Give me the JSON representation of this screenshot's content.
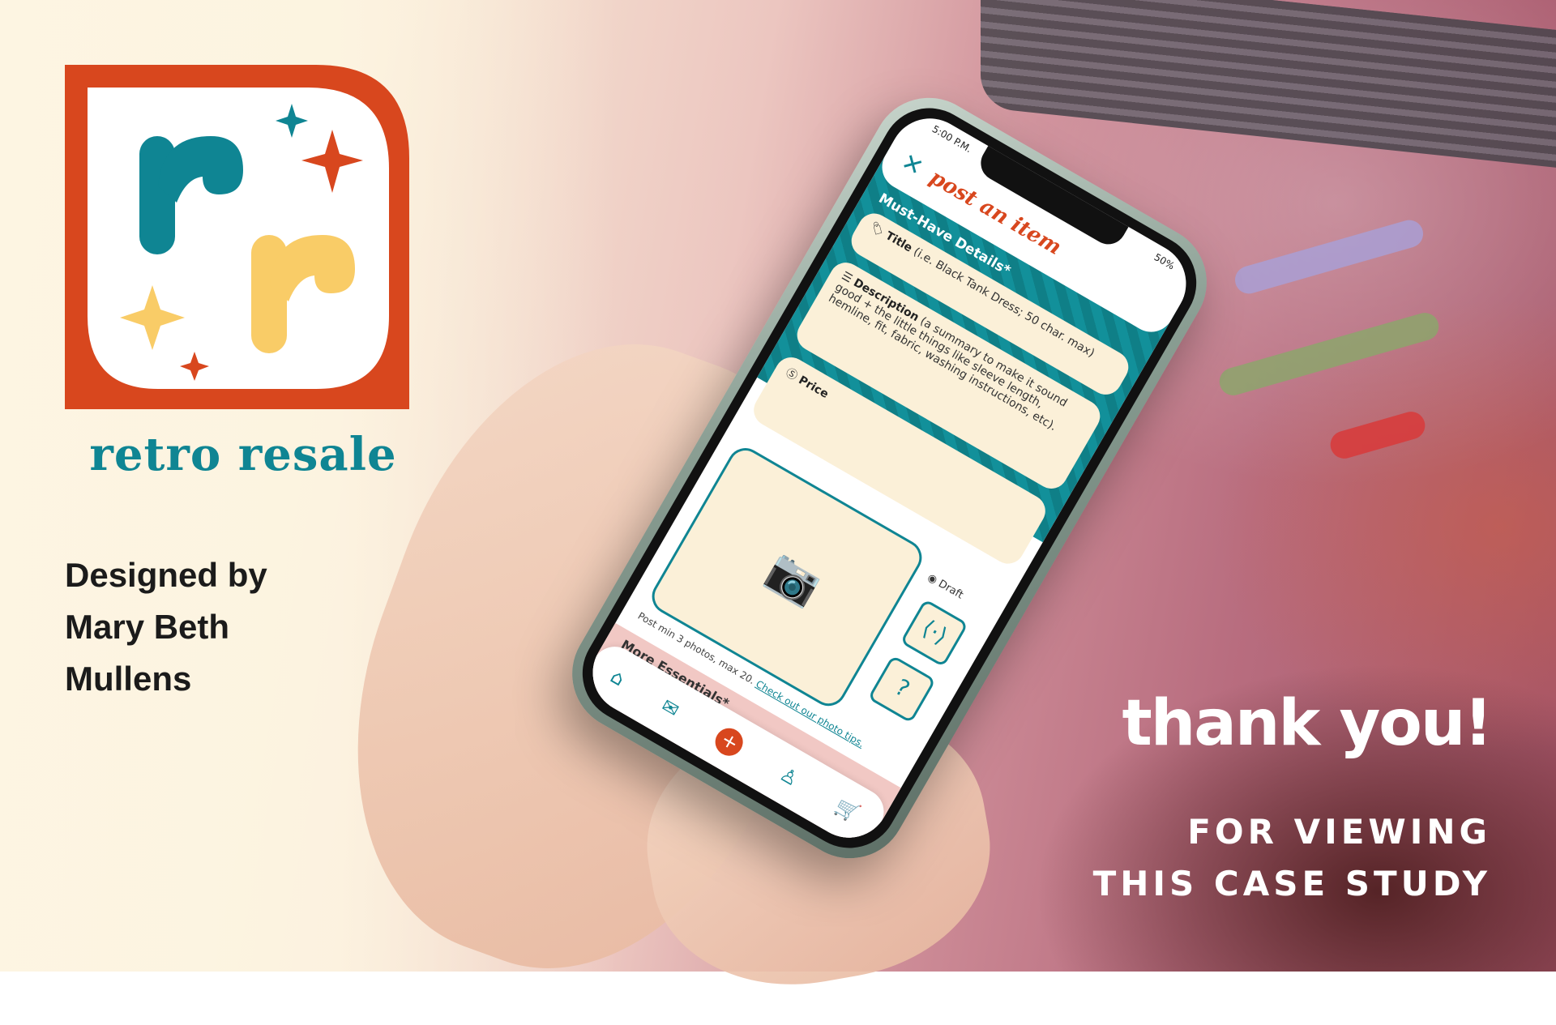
{
  "brand": {
    "name": "retro resale",
    "logo_letters": [
      "r",
      "r"
    ],
    "colors": {
      "teal": "#0f8593",
      "orange": "#d8471e",
      "yellow": "#f9cc67",
      "cream": "#fbf0d8"
    }
  },
  "credits": {
    "line1": "Designed by",
    "line2": "Mary Beth",
    "line3": "Mullens"
  },
  "closing": {
    "thanks": "thank you!",
    "line1": "FOR VIEWING",
    "line2": "THIS CASE STUDY"
  },
  "phone": {
    "status": {
      "time": "5:00 P.M.",
      "battery": "50%"
    },
    "header": {
      "close_icon": "close-icon",
      "title": "post an item"
    },
    "section_label": "Must-Have Details*",
    "fields": [
      {
        "icon": "tag-icon",
        "label": "Title",
        "hint": "(i.e. Black Tank Dress; 50 char. max)"
      },
      {
        "icon": "document-icon",
        "label": "Description",
        "hint": "(a summary to make it sound good + the little things like sleeve length, hemline, fit, fabric, washing instructions, etc)."
      },
      {
        "icon": "price-icon",
        "label": "Price",
        "hint": ""
      }
    ],
    "photo": {
      "icon": "camera-icon",
      "note": "Post min 3 photos, max 20.",
      "link": "Check out our photo tips."
    },
    "side": {
      "draft_label": "Draft",
      "preview_icon": "preview-sign-icon",
      "help_icon": "help-book-icon"
    },
    "more_label": "More Essentials*",
    "tabbar": {
      "items": [
        "home-icon",
        "mail-icon",
        "add-icon",
        "profile-icon",
        "cart-icon"
      ],
      "add_symbol": "+"
    }
  }
}
